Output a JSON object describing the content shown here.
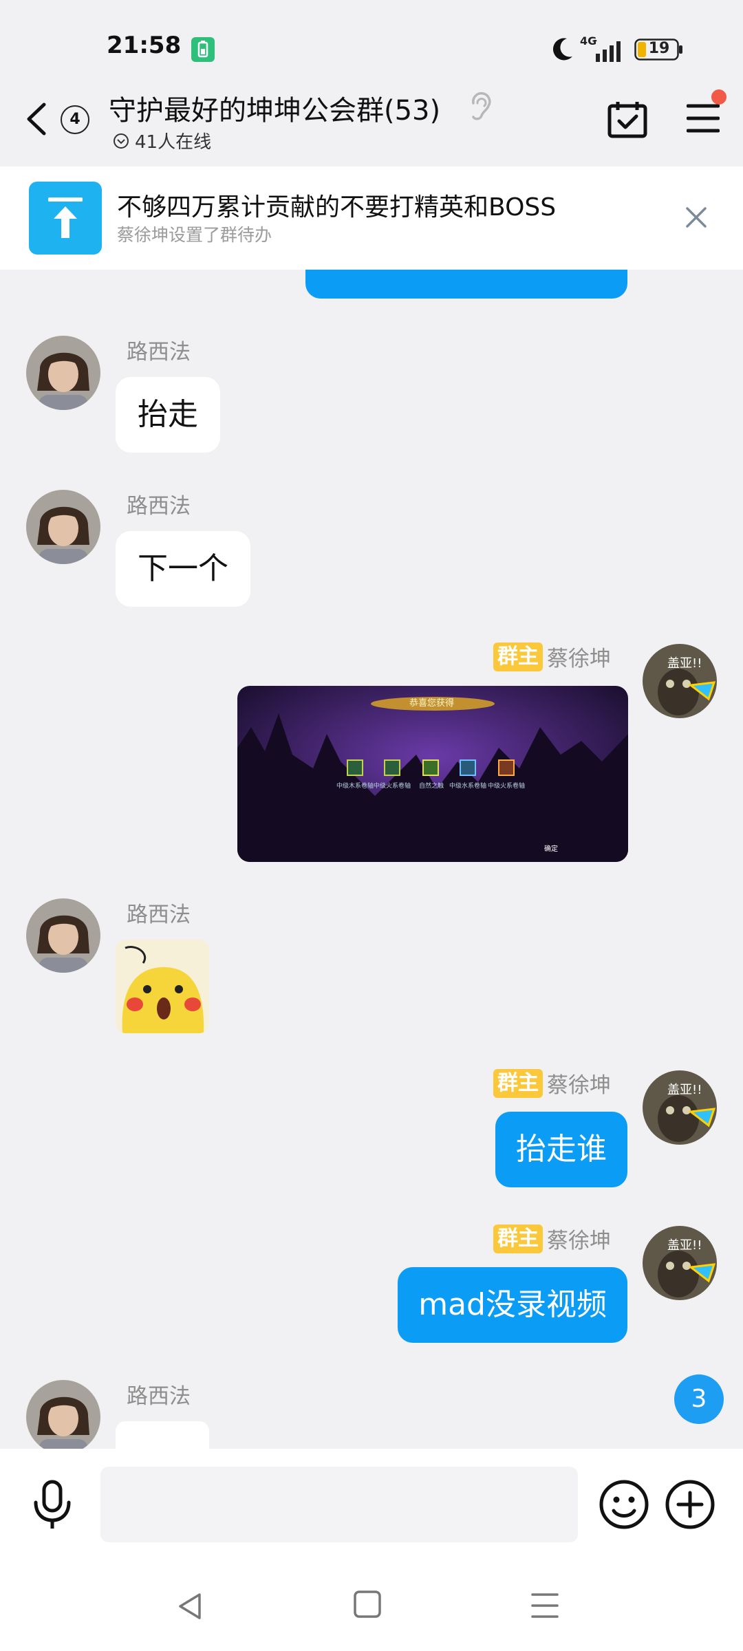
{
  "status_bar": {
    "time": "21:58",
    "network": "4G",
    "battery": "19"
  },
  "header": {
    "unread_count": "4",
    "title": "守护最好的坤坤公会群(53)",
    "online": "41人在线"
  },
  "pinned_todo": {
    "title": "不够四万累计贡献的不要打精英和BOSS",
    "subtitle": "蔡徐坤设置了群待办"
  },
  "messages": {
    "m1": {
      "sender": "路西法",
      "text": "抬走"
    },
    "m2": {
      "sender": "路西法",
      "text": "下一个"
    },
    "m3": {
      "badge": "群主",
      "sender": "蔡徐坤",
      "image": {
        "banner": "恭喜您获得",
        "items": [
          "中级木系卷轴",
          "中级火系卷轴",
          "自然之触",
          "中级水系卷轴",
          "中级火系卷轴"
        ],
        "confirm": "确定"
      }
    },
    "m4": {
      "sender": "路西法"
    },
    "m5": {
      "badge": "群主",
      "sender": "蔡徐坤",
      "text": "抬走谁"
    },
    "m6": {
      "badge": "群主",
      "sender": "蔡徐坤",
      "text": "mad没录视频"
    },
    "m7": {
      "sender": "路西法"
    },
    "owner_avatar_caption": "盖亚!!"
  },
  "new_message_count": "3",
  "colors": {
    "accent_blue": "#0b9cf5",
    "owner_badge": "#fcc83b",
    "pin_blue": "#1fb2f0",
    "notification_dot": "#f05a46"
  }
}
